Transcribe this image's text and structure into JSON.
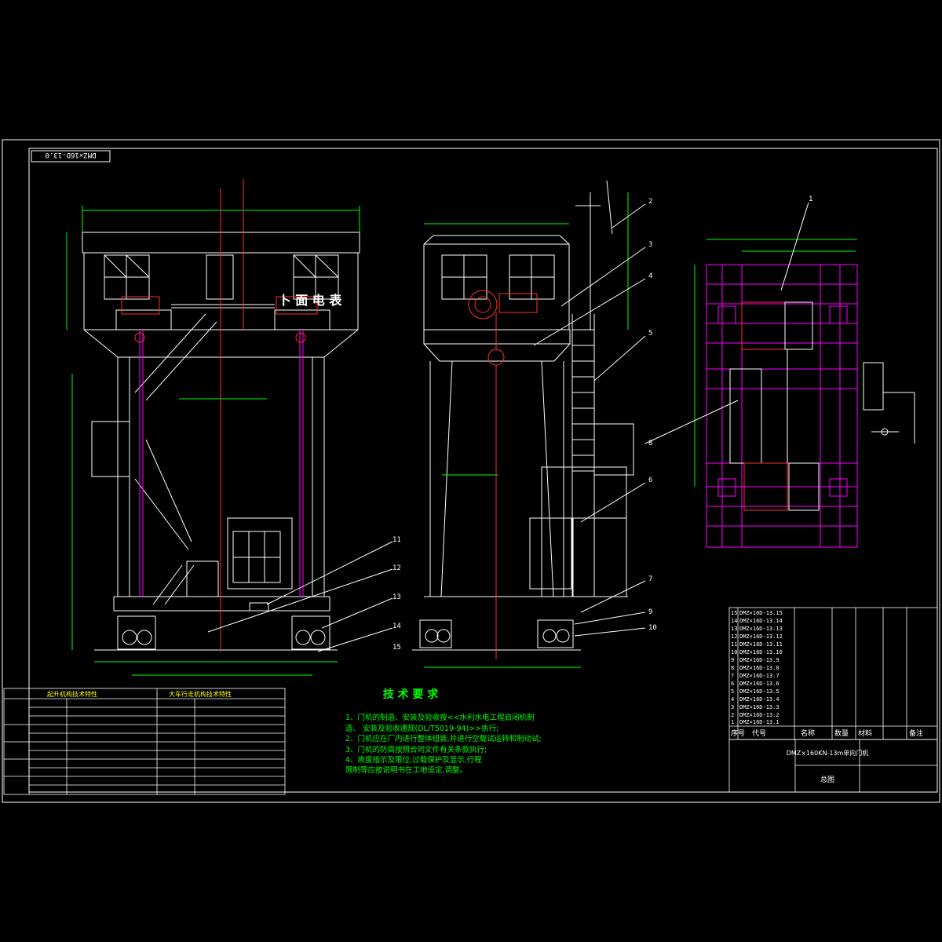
{
  "drawing": {
    "background": "#000000",
    "colors": {
      "frame": "#ffffff",
      "structure": "#ffffff",
      "dimension": "#00ff00",
      "rail": "#ff00ff",
      "hoist": "#ff3030",
      "note": "#00ff00",
      "table_text": "#ffff00"
    },
    "corner_code": "DMZ×16D-13.0",
    "crane_label": "卜 面 电 表",
    "notes": {
      "title": "技 术 要 求",
      "lines": [
        "1、门机的制造、安装及验收按<<水利水电工程启闭机制",
        "造、 安装及验收通规(DL/T5019-94)>>执行;",
        "2、门机应在厂内进行整体组装,并进行空载试运转和制动试;",
        "3、门机的防腐按照合同文件有关条款执行;",
        "4、高度指示及限位,过载保护及显示,行程",
        "限制等应按说明书在工地设定,调整。"
      ]
    },
    "callouts": [
      "1",
      "2",
      "3",
      "4",
      "5",
      "6",
      "7",
      "8",
      "9",
      "10",
      "11",
      "12",
      "13",
      "14",
      "15"
    ],
    "parts_table": {
      "headers": [
        "序号",
        "代号",
        "名称",
        "数量",
        "材料",
        "备注"
      ],
      "rows": [
        [
          "15",
          "DMZ×16D-13.15"
        ],
        [
          "14",
          "DMZ×16D-13.14"
        ],
        [
          "13",
          "DMZ×16D-13.13"
        ],
        [
          "12",
          "DMZ×16D-13.12"
        ],
        [
          "11",
          "DMZ×16D-13.11"
        ],
        [
          "10",
          "DMZ×16D-13.10"
        ],
        [
          "9",
          "DMZ×16D-13.9"
        ],
        [
          "8",
          "DMZ×16D-13.8"
        ],
        [
          "7",
          "DMZ×16D-13.7"
        ],
        [
          "6",
          "DMZ×16D-13.6"
        ],
        [
          "5",
          "DMZ×16D-13.5"
        ],
        [
          "4",
          "DMZ×16D-13.4"
        ],
        [
          "3",
          "DMZ×16D-13.3"
        ],
        [
          "2",
          "DMZ×16D-13.2"
        ],
        [
          "1",
          "DMZ×16D-13.1"
        ]
      ]
    },
    "title_block": {
      "name": "DMZ×160KN-13m单向门机",
      "subtitle": "总图"
    },
    "tech_tables": {
      "left_title": "起升机构技术特性",
      "right_title": "大车行走机构技术特性"
    }
  }
}
